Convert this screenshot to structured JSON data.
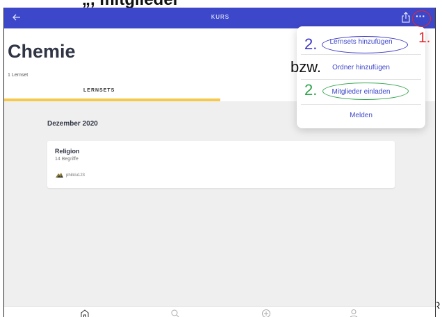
{
  "top_strip_text": "„, mitglieder",
  "navbar": {
    "title": "KURS",
    "icons": [
      "back-arrow-icon",
      "share-icon",
      "more-icon"
    ]
  },
  "header": {
    "title": "Chemie",
    "set_count": "1 Lernset",
    "tab": "LERNSETS",
    "tab_accent": "#f6c94a"
  },
  "content": {
    "month": "Dezember 2020",
    "card": {
      "title": "Religion",
      "terms": "14 Begriffe",
      "user": "philklu123"
    }
  },
  "menu": {
    "items": [
      {
        "label": "Lernsets hinzufügen"
      },
      {
        "label": "Ordner hinzufügen"
      },
      {
        "label": "Mitglieder einladen"
      },
      {
        "label": "Melden"
      }
    ]
  },
  "annotations": {
    "step1": "1.",
    "step2a": "2.",
    "bzw": "bzw.",
    "step2b": "2.",
    "colors": {
      "red": "#e8262b",
      "blue": "#3a37c4",
      "green": "#2ea34a"
    }
  },
  "tabbar": {
    "icons": [
      "home-icon",
      "search-icon",
      "add-icon",
      "profile-icon"
    ]
  },
  "colors": {
    "brand": "#3d47c9",
    "background": "#efefef"
  }
}
